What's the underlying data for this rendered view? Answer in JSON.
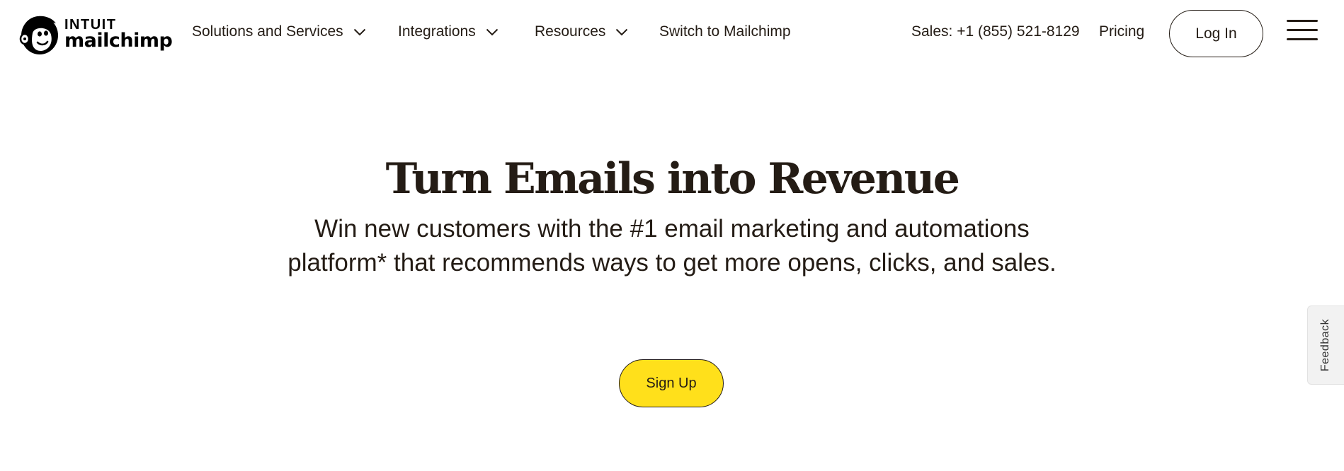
{
  "brand": {
    "line1": "INTUIT",
    "line2": "mailchimp",
    "logo_icon": "freddie-chimp-icon"
  },
  "nav": {
    "items": [
      {
        "label": "Solutions and Services",
        "icon": "chevron-down-icon"
      },
      {
        "label": "Integrations",
        "icon": "chevron-down-icon"
      },
      {
        "label": "Resources",
        "icon": "chevron-down-icon"
      },
      {
        "label": "Switch to Mailchimp"
      }
    ],
    "sales_phone": "Sales: +1 (855) 521-8129",
    "pricing_label": "Pricing",
    "login_label": "Log In",
    "menu_icon": "hamburger-menu-icon"
  },
  "hero": {
    "title": "Turn Emails into Revenue",
    "subtitle": "Win new customers with the #1 email marketing and automations platform* that recommends ways to get more opens, clicks, and sales.",
    "cta_label": "Sign Up"
  },
  "feedback": {
    "label": "Feedback"
  },
  "colors": {
    "text": "#241c15",
    "cta_background": "#ffe01b",
    "background": "#ffffff",
    "feedback_background": "#f2f2f2"
  }
}
